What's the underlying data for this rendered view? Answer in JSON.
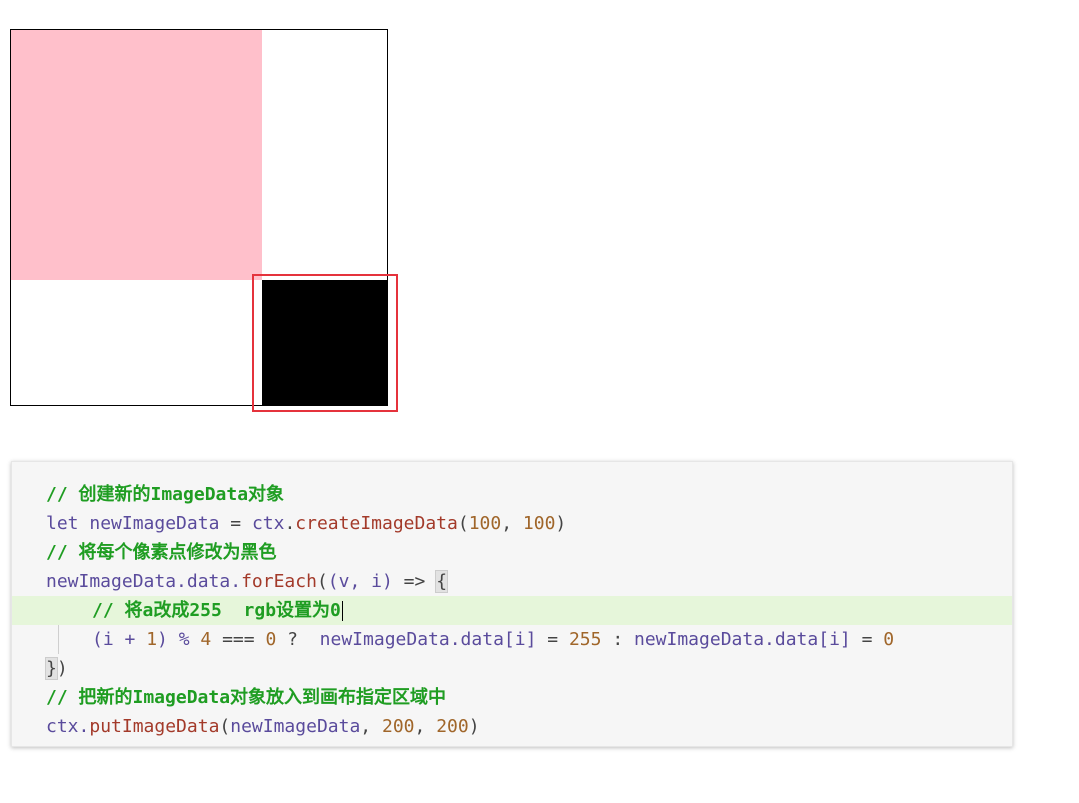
{
  "canvas": {
    "background": "#ffffff",
    "pink_color": "#ffc0cb",
    "black_color": "#000000",
    "highlight_color": "#e5323c"
  },
  "code": {
    "line1_comment": "// 创建新的ImageData对象",
    "line2_let": "let",
    "line2_var": "newImageData",
    "line2_eq": "=",
    "line2_obj": "ctx",
    "line2_dot": ".",
    "line2_func": "createImageData",
    "line2_open": "(",
    "line2_num1": "100",
    "line2_comma": ",",
    "line2_num2": "100",
    "line2_close": ")",
    "line3_comment": "// 将每个像素点修改为黑色",
    "line4_obj": "newImageData.data.",
    "line4_func": "forEach",
    "line4_open": "(",
    "line4_params": "(v, i)",
    "line4_arrow": "=>",
    "line4_brace": "{",
    "line5_comment": "// 将a改成255  rgb设置为0",
    "line6_open": "(i +",
    "line6_num1": "1",
    "line6_mid": ") %",
    "line6_num4": "4",
    "line6_eqeq": "===",
    "line6_num0": "0",
    "line6_q": "?",
    "line6_lhs": "newImageData.data[i]",
    "line6_eq1": "=",
    "line6_num255": "255",
    "line6_colon": ":",
    "line6_rhs": "newImageData.data[i]",
    "line6_eq2": "=",
    "line6_num0b": "0",
    "line7_brace": "}",
    "line7_close": ")",
    "line8_comment": "// 把新的ImageData对象放入到画布指定区域中",
    "line9_obj": "ctx.",
    "line9_func": "putImageData",
    "line9_open": "(",
    "line9_var": "newImageData",
    "line9_comma1": ",",
    "line9_num1": "200",
    "line9_comma2": ",",
    "line9_num2": "200",
    "line9_close": ")"
  }
}
